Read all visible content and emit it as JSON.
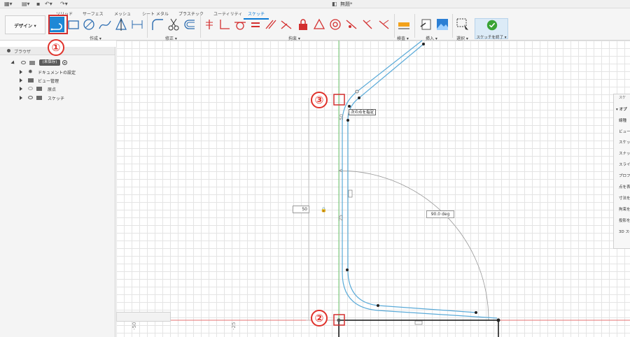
{
  "title_bar": {
    "document_title": "無題*"
  },
  "toolbar": {
    "workspace_label": "デザイン ▾",
    "tabs": [
      "ソリッド",
      "サーフェス",
      "メッシュ",
      "シート メタル",
      "プラスチック",
      "ユーティリティ",
      "スケッチ"
    ],
    "active_tab": "スケッチ",
    "groups": {
      "create": "作成 ▾",
      "modify": "修正 ▾",
      "constraints": "拘束 ▾",
      "inspect": "検査 ▾",
      "insert": "挿入 ▾",
      "select": "選択 ▾"
    },
    "finish_sketch": "スケッチを終了 ▾",
    "accent_color": "#1e88d6",
    "constraint_color": "#d32f2f"
  },
  "browser": {
    "title": "ブラウザ",
    "root_label": "(未保存)",
    "items": [
      {
        "label": "ドキュメントの設定",
        "icon": "gear-icon"
      },
      {
        "label": "ビュー管理",
        "icon": "folder-icon"
      },
      {
        "label": "原点",
        "icon": "folder-icon"
      },
      {
        "label": "スケッチ",
        "icon": "folder-icon"
      }
    ]
  },
  "palette": {
    "header": "スケ",
    "section": "▾ オプ",
    "rows": [
      "線種",
      "ビュー",
      "スケッチ",
      "スナップ",
      "スライ",
      "プロファ",
      "点を表",
      "寸法を",
      "拘束を",
      "投影を",
      "3D スケ"
    ]
  },
  "canvas": {
    "tooltip": "次の点を指定",
    "dimension_value": "50",
    "angle_value": "90.0 deg",
    "axis_labels": [
      "50",
      "25"
    ],
    "ruler_labels": [
      "-50",
      "-25"
    ]
  },
  "annotations": {
    "badge_1": "①",
    "badge_2": "②",
    "badge_3": "③",
    "badge_color": "#e0312a"
  }
}
